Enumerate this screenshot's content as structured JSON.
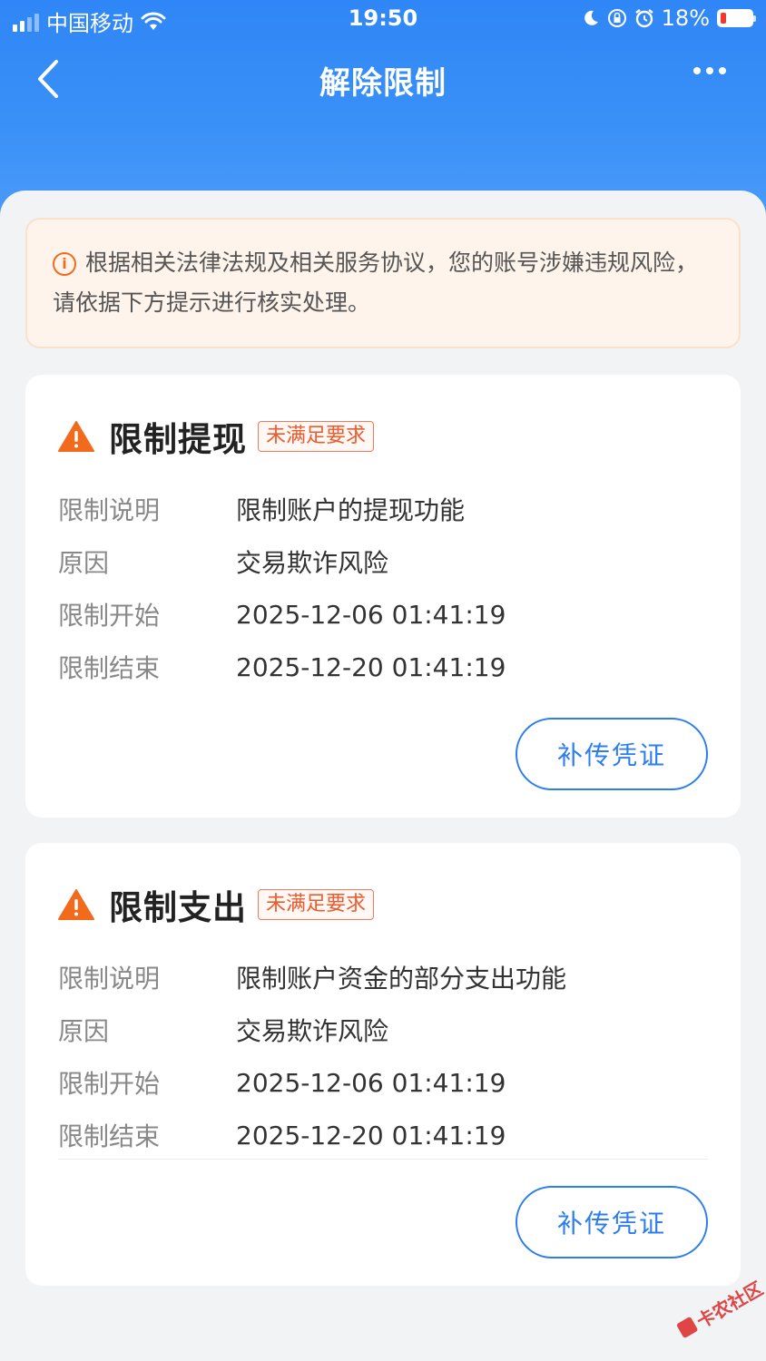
{
  "status_bar": {
    "carrier": "中国移动",
    "time": "19:50",
    "battery": "18%",
    "battery_level": 0.18
  },
  "navbar": {
    "title": "解除限制",
    "back_icon": "chevron-left-icon",
    "more_icon": "more-dots-icon"
  },
  "notice": {
    "icon": "info-icon",
    "text": "根据相关法律法规及相关服务协议，您的账号涉嫌违规风险，请依据下方提示进行核实处理。"
  },
  "restrictions": [
    {
      "title": "限制提现",
      "badge": "未满足要求",
      "rows": [
        {
          "label": "限制说明",
          "value": "限制账户的提现功能"
        },
        {
          "label": "原因",
          "value": "交易欺诈风险"
        },
        {
          "label": "限制开始",
          "value": "2025-12-06 01:41:19"
        },
        {
          "label": "限制结束",
          "value": "2025-12-20 01:41:19"
        }
      ],
      "button": "补传凭证"
    },
    {
      "title": "限制支出",
      "badge": "未满足要求",
      "rows": [
        {
          "label": "限制说明",
          "value": "限制账户资金的部分支出功能"
        },
        {
          "label": "原因",
          "value": "交易欺诈风险"
        },
        {
          "label": "限制开始",
          "value": "2025-12-06 01:41:19"
        },
        {
          "label": "限制结束",
          "value": "2025-12-20 01:41:19"
        }
      ],
      "button": "补传凭证"
    }
  ],
  "watermark": "卡农社区",
  "colors": {
    "primary": "#2c7df0",
    "header": "#2f86f6",
    "warning": "#f26b1d",
    "badge": "#ee5a2c"
  }
}
